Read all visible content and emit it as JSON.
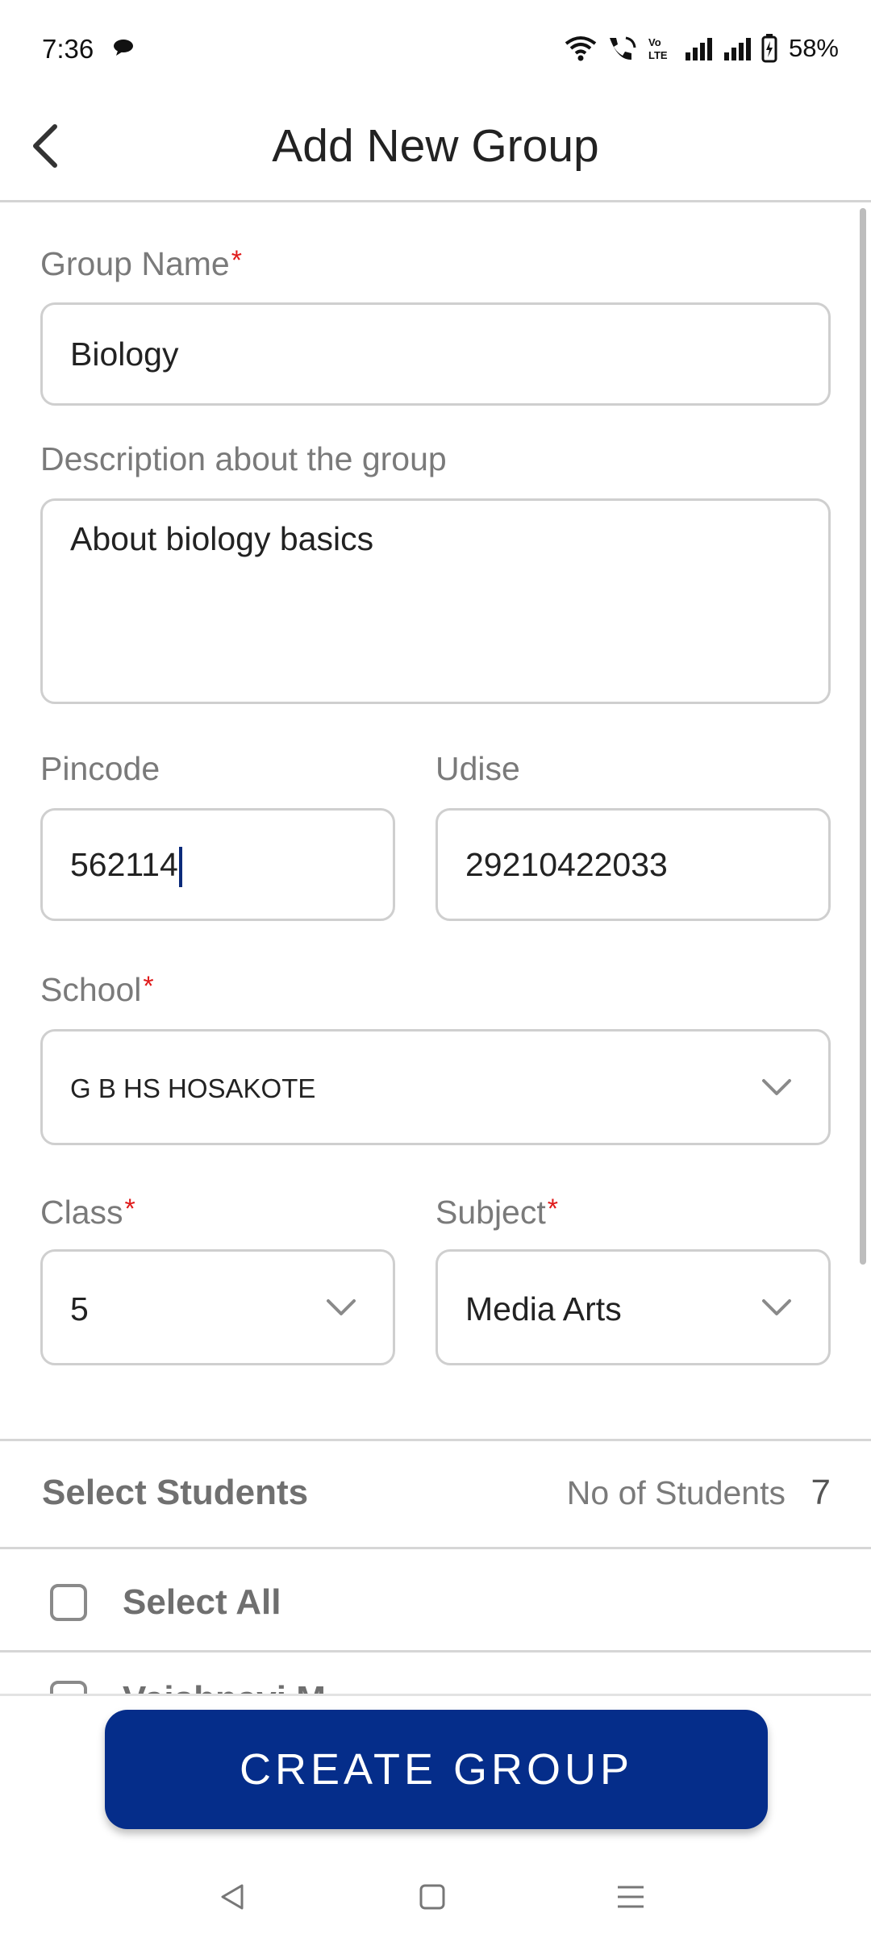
{
  "status_bar": {
    "time": "7:36",
    "battery": "58%",
    "icons": [
      "chat-bubble-icon",
      "wifi-icon",
      "wifi-calling-icon",
      "volte-icon",
      "signal-icon",
      "signal-icon",
      "battery-icon"
    ]
  },
  "header": {
    "back_icon": "chevron-left-icon",
    "title": "Add New Group"
  },
  "form": {
    "group_name": {
      "label": "Group Name",
      "required_mark": "*",
      "value": "Biology"
    },
    "description": {
      "label": "Description about the group",
      "value": "About biology basics"
    },
    "pincode": {
      "label": "Pincode",
      "value": "562114"
    },
    "udise": {
      "label": "Udise",
      "value": "29210422033"
    },
    "school": {
      "label": "School",
      "required_mark": "*",
      "value": "G B HS HOSAKOTE"
    },
    "class": {
      "label": "Class",
      "required_mark": "*",
      "value": "5"
    },
    "subject": {
      "label": "Subject",
      "required_mark": "*",
      "value": "Media Arts"
    }
  },
  "students": {
    "title": "Select Students",
    "count_label": "No of Students",
    "count": "7",
    "select_all_label": "Select All",
    "partial_item_label": "Vaishnavi M"
  },
  "actions": {
    "create_group_label": "CREATE GROUP"
  },
  "colors": {
    "primary_button": "#052d8a",
    "required_mark": "#e01b1b",
    "label_gray": "#7a7a7a",
    "border_gray": "#cfcfcf"
  }
}
